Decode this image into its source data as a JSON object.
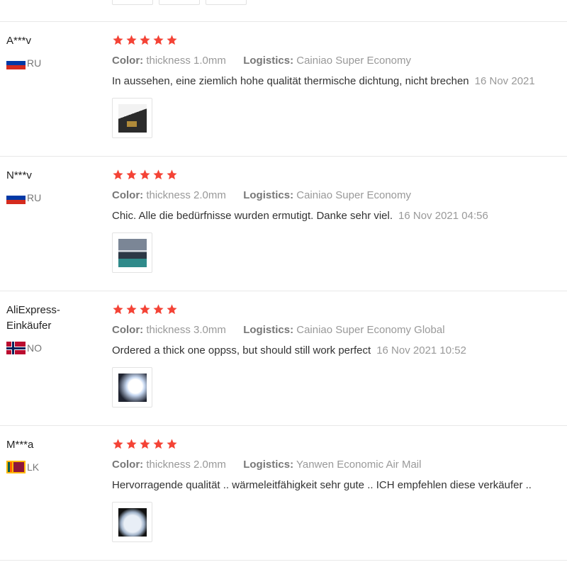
{
  "reviews": [
    {
      "name": "A***v",
      "country": "RU",
      "flag": "russia-flag",
      "rating": 5,
      "color_label": "Color:",
      "color_value": "thickness 1.0mm",
      "logistics_label": "Logistics:",
      "logistics_value": "Cainiao Super Economy",
      "text": "In aussehen, eine ziemlich hohe qualität thermische dichtung, nicht brechen",
      "date": "16 Nov 2021"
    },
    {
      "name": "N***v",
      "country": "RU",
      "flag": "russia-flag",
      "rating": 5,
      "color_label": "Color:",
      "color_value": "thickness 2.0mm",
      "logistics_label": "Logistics:",
      "logistics_value": "Cainiao Super Economy",
      "text": "Chic. Alle die bedürfnisse wurden ermutigt. Danke sehr viel.",
      "date": "16 Nov 2021 04:56"
    },
    {
      "name": "AliExpress-Einkäufer",
      "country": "NO",
      "flag": "norway-flag",
      "rating": 5,
      "color_label": "Color:",
      "color_value": "thickness 3.0mm",
      "logistics_label": "Logistics:",
      "logistics_value": "Cainiao Super Economy Global",
      "text": "Ordered a thick one oppss, but should still work perfect",
      "date": "16 Nov 2021 10:52"
    },
    {
      "name": "M***a",
      "country": "LK",
      "flag": "sri-lanka-flag",
      "rating": 5,
      "color_label": "Color:",
      "color_value": "thickness 2.0mm",
      "logistics_label": "Logistics:",
      "logistics_value": "Yanwen Economic Air Mail",
      "text": "Hervorragende qualität .. wärmeleitfähigkeit sehr gute .. ICH empfehlen diese verkäufer ..",
      "date": ""
    }
  ],
  "colors": {
    "star": "#f44336",
    "divider": "#e8e8e8",
    "meta": "#999999"
  }
}
